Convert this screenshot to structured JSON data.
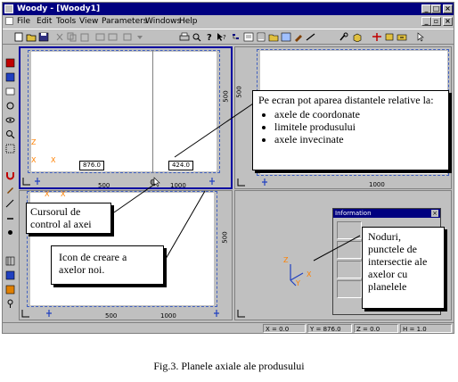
{
  "window": {
    "title": "Woody - [Woody1]",
    "controls": [
      "_",
      "□",
      "×"
    ],
    "mdi_controls": [
      "_",
      "▫",
      "×"
    ]
  },
  "menu": [
    "File",
    "Edit",
    "Tools",
    "View",
    "Parameters",
    "Windows",
    "Help"
  ],
  "panes": {
    "top_left": {
      "ruler_left": "500",
      "ruler_bottom": [
        "500",
        "1000"
      ],
      "values": [
        "876.0",
        "424.0"
      ]
    },
    "top_right": {
      "ruler_left": "500",
      "ruler_bottom": "1000"
    },
    "bottom_left": {
      "ruler_left": "500",
      "ruler_bottom": [
        "500",
        "1000"
      ]
    }
  },
  "info_window": {
    "title": "Information"
  },
  "callouts": {
    "top": {
      "intro": "Pe ecran pot aparea distantele relative la:",
      "items": [
        "axele de coordonate",
        "limitele produsului",
        "axele invecinate"
      ]
    },
    "cursor": "Cursorul de control al axei",
    "icon": "Icon de creare a axelor noi.",
    "nodes": "Noduri, punctele de intersectie ale axelor cu planelele"
  },
  "status": {
    "x": "X = 0.0",
    "y": "Y = 876.0",
    "z": "Z = 0.0",
    "h": "H = 1.0"
  },
  "caption": "Fig.3. Planele axiale ale produsului",
  "colors": {
    "titlebar": "#000080",
    "accent": "#0000a0",
    "axis_orange": "#ff8000",
    "axis_blue": "#2040c0",
    "dash": "#4060c0"
  }
}
